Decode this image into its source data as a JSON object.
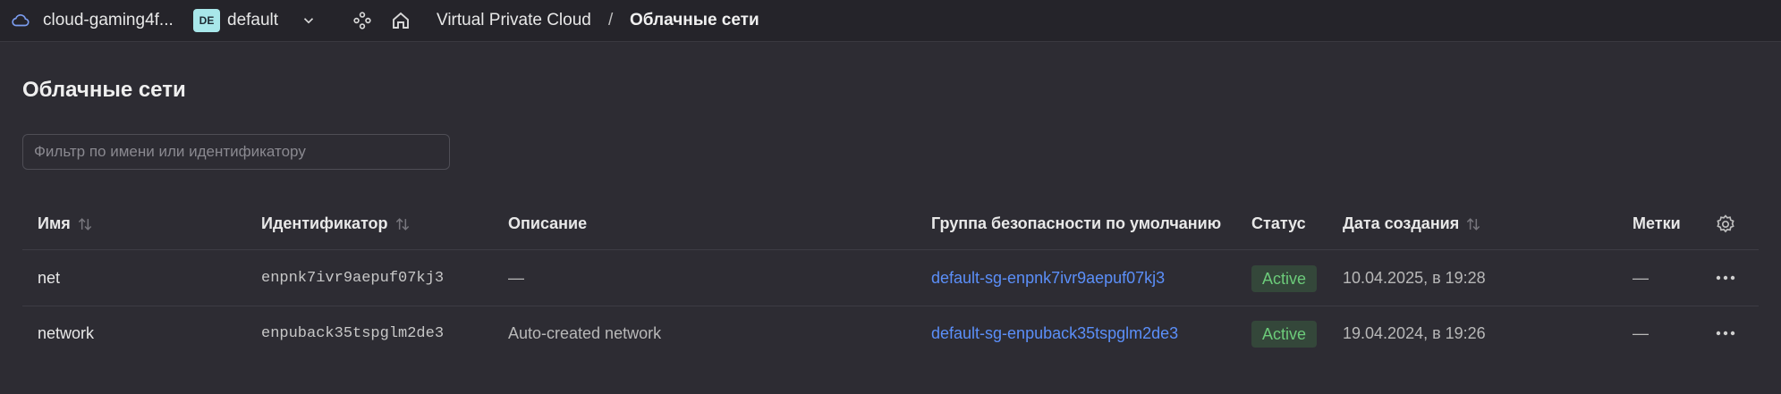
{
  "topbar": {
    "cloud_name": "cloud-gaming4f...",
    "folder_badge": "DE",
    "folder_name": "default",
    "breadcrumb": {
      "service": "Virtual Private Cloud",
      "separator": "/",
      "current": "Облачные сети"
    },
    "icons": [
      "cloud-icon",
      "chevron-down-icon",
      "services-icon",
      "home-icon"
    ]
  },
  "page": {
    "title": "Облачные сети",
    "filter_placeholder": "Фильтр по имени или идентификатору",
    "filter_value": ""
  },
  "table": {
    "columns": [
      {
        "label": "Имя",
        "sortable": true
      },
      {
        "label": "Идентификатор",
        "sortable": true
      },
      {
        "label": "Описание",
        "sortable": false
      },
      {
        "label": "Группа безопасности по умолчанию",
        "sortable": false
      },
      {
        "label": "Статус",
        "sortable": false
      },
      {
        "label": "Дата создания",
        "sortable": true
      },
      {
        "label": "Метки",
        "sortable": false
      }
    ],
    "rows": [
      {
        "name": "net",
        "id": "enpnk7ivr9aepuf07kj3",
        "description": "—",
        "security_group": "default-sg-enpnk7ivr9aepuf07kj3",
        "status": "Active",
        "created": "10.04.2025, в 19:28",
        "labels": "—"
      },
      {
        "name": "network",
        "id": "enpuback35tspglm2de3",
        "description": "Auto-created network",
        "security_group": "default-sg-enpuback35tspglm2de3",
        "status": "Active",
        "created": "19.04.2024, в 19:26",
        "labels": "—"
      }
    ]
  },
  "colors": {
    "background": "#2d2c33",
    "topbar": "#25242a",
    "link": "#5b8ff9",
    "status_active_bg": "#34473a",
    "status_active_text": "#6ccb7a",
    "folder_badge": "#a8e7ea"
  }
}
